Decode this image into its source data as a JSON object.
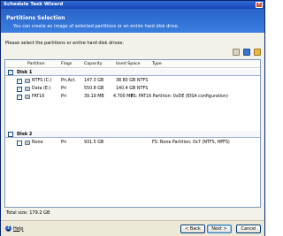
{
  "window": {
    "title": "Schedule Task Wizard",
    "close_glyph": "✕"
  },
  "header": {
    "title": "Partitions Selection",
    "subtitle": "You can create an image of selected partitions or an entire hard disk drive."
  },
  "instructions": "Please select the partitions or entire hard disk drives:",
  "toolbar": {
    "icons": [
      "disk-properties-icon",
      "partition-icon",
      "view-options-icon"
    ]
  },
  "columns": [
    "Partition",
    "Flags",
    "Capacity",
    "Used Space",
    "Type"
  ],
  "disks": [
    {
      "label": "Disk 1",
      "checked": true,
      "partitions": [
        {
          "name": "NTFS (C:)",
          "flags": "Pri,Act.",
          "capacity": "147.3 GB",
          "used": "38.80 GB",
          "type": "NTFS",
          "checked": true
        },
        {
          "name": "Data (E:)",
          "flags": "Pri",
          "capacity": "550.8 GB",
          "used": "140.4 GB",
          "type": "NTFS",
          "checked": true
        },
        {
          "name": "FAT16",
          "flags": "Pri",
          "capacity": "39.19 MB",
          "used": "4.700 MB",
          "type": "FS: FAT16 Partition: 0xDE (EISA configuration)",
          "checked": true
        }
      ]
    },
    {
      "label": "Disk 2",
      "checked": false,
      "partitions": [
        {
          "name": "None",
          "flags": "Pri",
          "capacity": "931.5 GB",
          "used": "",
          "type": "FS: None Partition: 0x7 (NTFS, HPFS)",
          "checked": false
        }
      ]
    }
  ],
  "total_size": "Total size: 179.2 GB",
  "footer": {
    "help": "Help",
    "back": "< Back",
    "next": "Next >",
    "cancel": "Cancel",
    "help_glyph": "?"
  },
  "colors": {
    "accent": "#2a64c8",
    "check": "#1f8a2a"
  }
}
